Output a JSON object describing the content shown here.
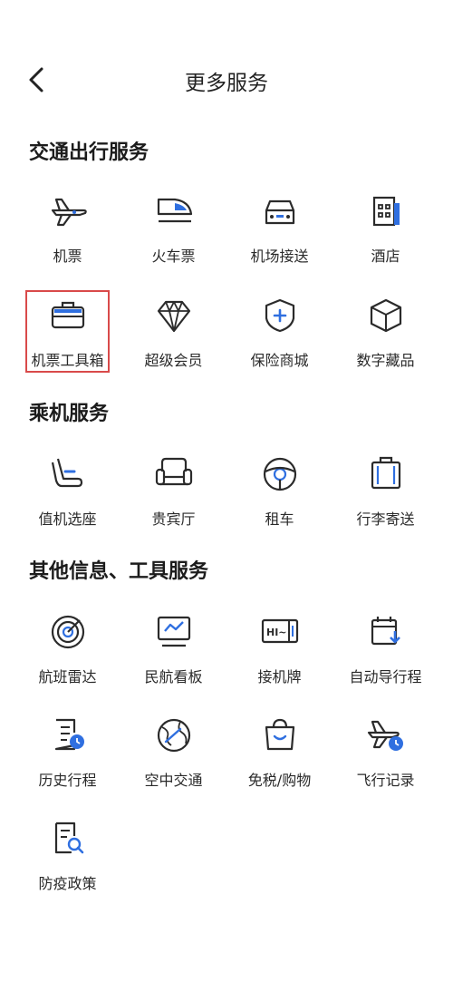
{
  "header": {
    "title": "更多服务"
  },
  "sections": [
    {
      "title": "交通出行服务"
    },
    {
      "title": "乘机服务"
    },
    {
      "title": "其他信息、工具服务"
    }
  ],
  "items": [
    {
      "label": "机票",
      "icon": "plane-icon"
    },
    {
      "label": "火车票",
      "icon": "train-icon"
    },
    {
      "label": "机场接送",
      "icon": "car-icon"
    },
    {
      "label": "酒店",
      "icon": "hotel-icon"
    },
    {
      "label": "机票工具箱",
      "icon": "briefcase-icon"
    },
    {
      "label": "超级会员",
      "icon": "diamond-icon"
    },
    {
      "label": "保险商城",
      "icon": "shield-plus-icon"
    },
    {
      "label": "数字藏品",
      "icon": "cube-icon"
    },
    {
      "label": "值机选座",
      "icon": "seat-icon"
    },
    {
      "label": "贵宾厅",
      "icon": "sofa-icon"
    },
    {
      "label": "租车",
      "icon": "steering-wheel-icon"
    },
    {
      "label": "行李寄送",
      "icon": "luggage-icon"
    },
    {
      "label": "航班雷达",
      "icon": "radar-icon"
    },
    {
      "label": "民航看板",
      "icon": "monitor-chart-icon"
    },
    {
      "label": "接机牌",
      "icon": "pickup-sign-icon"
    },
    {
      "label": "自动导行程",
      "icon": "calendar-import-icon"
    },
    {
      "label": "历史行程",
      "icon": "document-clock-icon"
    },
    {
      "label": "空中交通",
      "icon": "globe-plane-icon"
    },
    {
      "label": "免税/购物",
      "icon": "shopping-bag-icon"
    },
    {
      "label": "飞行记录",
      "icon": "plane-clock-icon"
    },
    {
      "label": "防疫政策",
      "icon": "document-search-icon"
    }
  ],
  "colors": {
    "icon_stroke": "#2b2b2b",
    "accent": "#2f6fe0",
    "highlight_border": "#d94a4a"
  }
}
